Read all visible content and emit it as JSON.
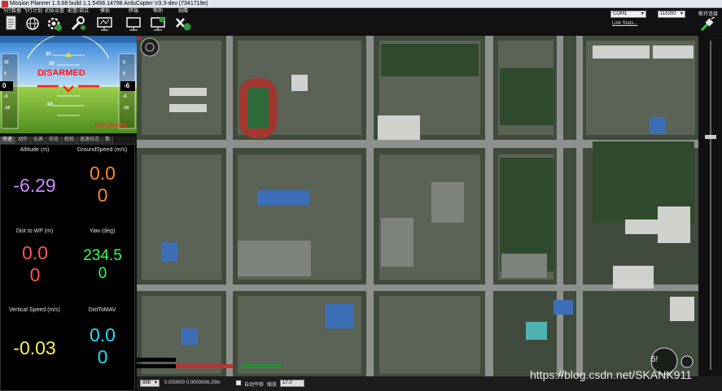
{
  "window": {
    "title": "Mission Planner 1.3.68 build 1.1.5456.14798 ArduCopter V3.3-dev (7341719e)"
  },
  "menu": [
    {
      "label": "飞行数据",
      "icon": "flight-data-icon"
    },
    {
      "label": "飞行计划",
      "icon": "globe-icon"
    },
    {
      "label": "初始设置",
      "icon": "setup-icon"
    },
    {
      "label": "配置/调试",
      "icon": "wrench-icon"
    },
    {
      "label": "模拟",
      "icon": "monitor-icon"
    },
    {
      "label": "终端",
      "icon": "terminal-icon"
    },
    {
      "label": "帮助",
      "icon": "help-icon"
    },
    {
      "label": "捐赠",
      "icon": "donate-icon"
    }
  ],
  "connection": {
    "port": "COM1",
    "baud": "115200",
    "link_stats": "Link Stats...",
    "connect_label": "断开连接"
  },
  "hud": {
    "status": "DISARMED",
    "gps": "GPS: No GPS",
    "left_value": "0",
    "right_value": "-6",
    "pitch_labels": [
      "30",
      "20",
      "10",
      "-10"
    ],
    "left_ticks": [
      "10",
      "5",
      "0",
      "-5",
      "-10"
    ],
    "right_ticks": [
      "5",
      "0",
      "-5",
      "-10"
    ]
  },
  "tabs": [
    "快速",
    "动作",
    "仪表",
    "状态",
    "舵机",
    "遥测日志",
    "数"
  ],
  "quick": [
    {
      "label": "Altitude (m)",
      "value": "-6.29",
      "color": "#cc88ff"
    },
    {
      "label": "GroundSpeed (m/s)",
      "value": "0.00",
      "color": "#ff8c1a"
    },
    {
      "label": "Dist to WP (m)",
      "value": "0.00",
      "color": "#ff5555"
    },
    {
      "label": "Yaw (deg)",
      "value": "234.50",
      "color": "#33ff55"
    },
    {
      "label": "Vertical Speed (m/s)",
      "value": "-0.03",
      "color": "#ffee55"
    },
    {
      "label": "DistToMAV",
      "value": "0.00",
      "color": "#22ddff"
    }
  ],
  "map_overlay": {
    "zoom": "5!"
  },
  "bottom_bar": {
    "map_type": "888",
    "coords": "0.000000 0.000000",
    "alt": "-6.29m",
    "auto_pan": "自动平移",
    "zoom_label": "缩放",
    "zoom_value": "17.0"
  },
  "watermark": "https://blog.csdn.net/SKANK911"
}
